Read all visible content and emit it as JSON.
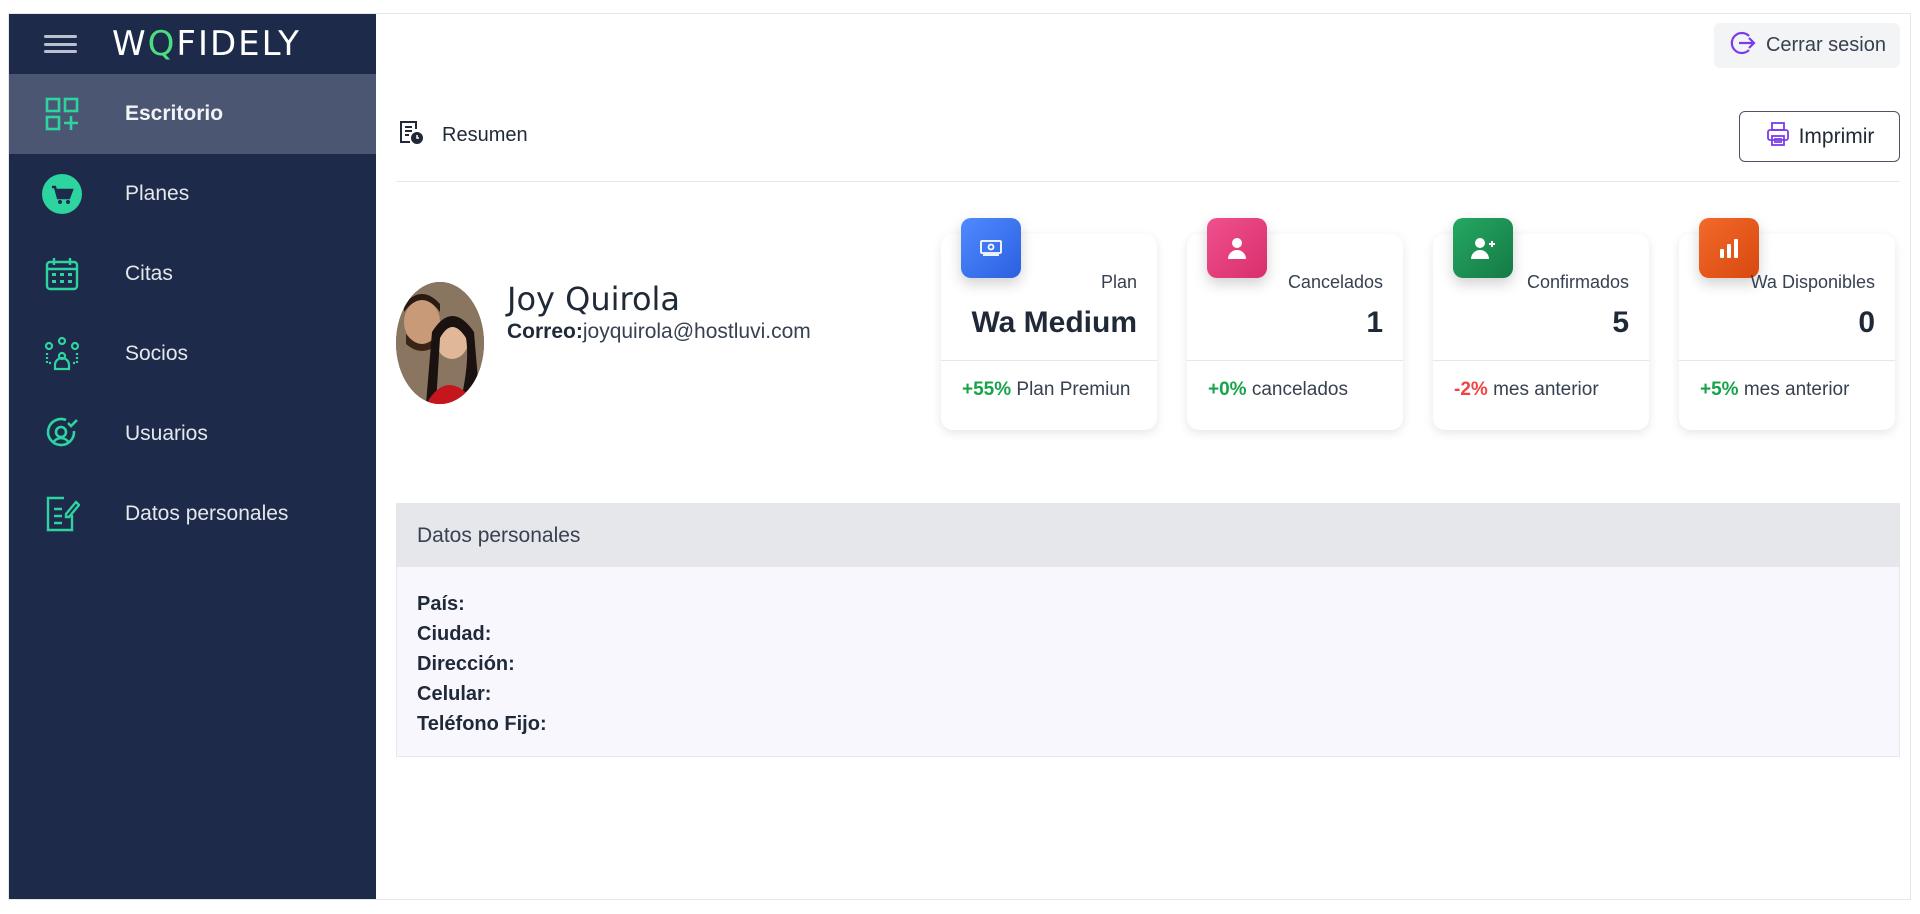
{
  "brand": {
    "logo_pre": "W",
    "logo_q": "Q",
    "logo_post": "FIDELY"
  },
  "sidebar": {
    "items": [
      {
        "label": "Escritorio",
        "icon": "grid-plus-icon",
        "active": true
      },
      {
        "label": "Planes",
        "icon": "cart-icon",
        "active": false
      },
      {
        "label": "Citas",
        "icon": "calendar-icon",
        "active": false
      },
      {
        "label": "Socios",
        "icon": "network-users-icon",
        "active": false
      },
      {
        "label": "Usuarios",
        "icon": "user-check-icon",
        "active": false
      },
      {
        "label": "Datos personales",
        "icon": "edit-document-icon",
        "active": false
      }
    ]
  },
  "header": {
    "logout_label": "Cerrar sesion"
  },
  "toolbar": {
    "section_title": "Resumen",
    "print_label": "Imprimir"
  },
  "profile": {
    "name": "Joy Quirola",
    "email_label": "Correo:",
    "email": "joyquirola@hostluvi.com"
  },
  "cards": [
    {
      "title": "Plan",
      "value": "Wa Medium",
      "pct": "+55%",
      "pct_color": "green",
      "foot": " Plan Premiun",
      "icon": "money-icon",
      "color": "#3b6ff0"
    },
    {
      "title": "Cancelados",
      "value": "1",
      "pct": "+0%",
      "pct_color": "green",
      "foot": " cancelados",
      "icon": "user-icon",
      "color": "#e8417f"
    },
    {
      "title": "Confirmados",
      "value": "5",
      "pct": "-2%",
      "pct_color": "red",
      "foot": " mes anterior",
      "icon": "user-plus-icon",
      "color": "#1f9254"
    },
    {
      "title": "Wa Disponibles",
      "value": "0",
      "pct": "+5%",
      "pct_color": "green",
      "foot": " mes anterior",
      "icon": "bar-chart-icon",
      "color": "#ea5a1a"
    }
  ],
  "personal": {
    "title": "Datos personales",
    "fields": [
      "País:",
      "Ciudad:",
      "Dirección:",
      "Celular:",
      "Teléfono Fijo:"
    ]
  },
  "colors": {
    "sidebar_bg": "#1e2a4a",
    "active_bg": "#4a5672",
    "icon_green": "#2dd4a0",
    "logout_purple": "#7c3aed"
  }
}
